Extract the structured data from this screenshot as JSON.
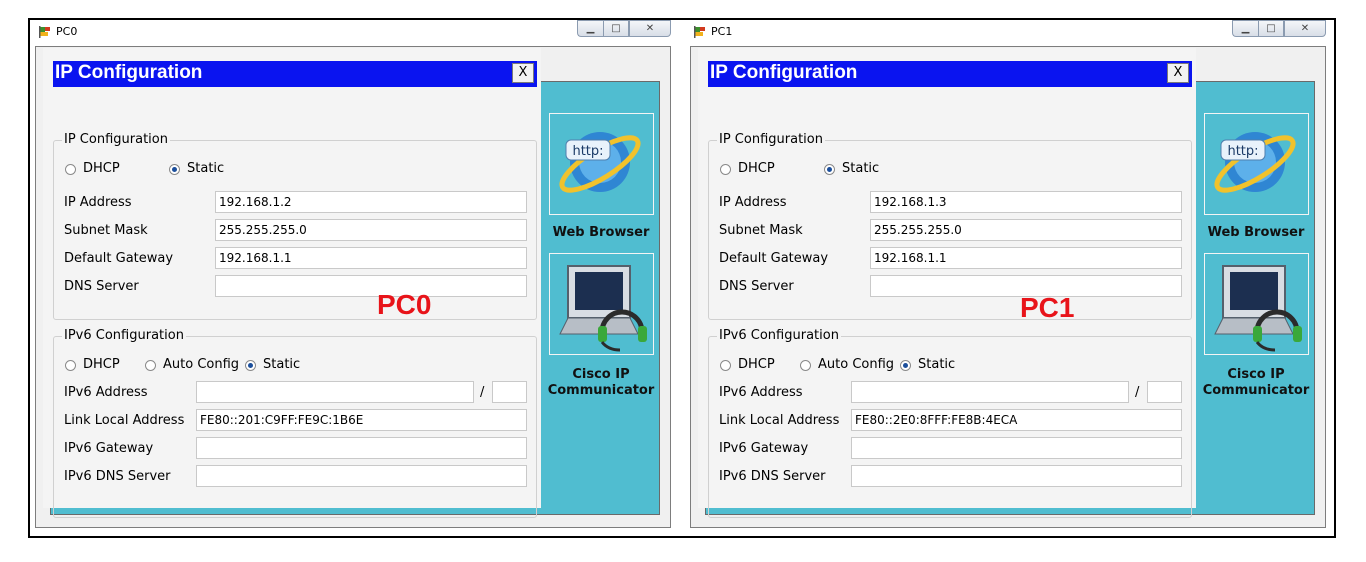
{
  "windows": [
    {
      "title": "PC0",
      "overlay_label": "PC0",
      "dialog_title": "IP Configuration",
      "close_label": "X",
      "ipv4": {
        "group_title": "IP Configuration",
        "dhcp_label": "DHCP",
        "static_label": "Static",
        "mode": "Static",
        "ip_label": "IP Address",
        "ip": "192.168.1.2",
        "mask_label": "Subnet Mask",
        "mask": "255.255.255.0",
        "gw_label": "Default Gateway",
        "gw": "192.168.1.1",
        "dns_label": "DNS Server",
        "dns": ""
      },
      "ipv6": {
        "group_title": "IPv6 Configuration",
        "dhcp_label": "DHCP",
        "auto_label": "Auto Config",
        "static_label": "Static",
        "mode": "Static",
        "addr_label": "IPv6 Address",
        "addr": "",
        "prefix_sep": "/",
        "prefix": "",
        "link_label": "Link Local Address",
        "link": "FE80::201:C9FF:FE9C:1B6E",
        "gw_label": "IPv6 Gateway",
        "gw": "",
        "dns_label": "IPv6 DNS Server",
        "dns": ""
      },
      "apps": [
        "Web Browser",
        "Cisco IP Communicator"
      ],
      "browser_icon_text": "http:"
    },
    {
      "title": "PC1",
      "overlay_label": "PC1",
      "dialog_title": "IP Configuration",
      "close_label": "X",
      "ipv4": {
        "group_title": "IP Configuration",
        "dhcp_label": "DHCP",
        "static_label": "Static",
        "mode": "Static",
        "ip_label": "IP Address",
        "ip": "192.168.1.3",
        "mask_label": "Subnet Mask",
        "mask": "255.255.255.0",
        "gw_label": "Default Gateway",
        "gw": "192.168.1.1",
        "dns_label": "DNS Server",
        "dns": ""
      },
      "ipv6": {
        "group_title": "IPv6 Configuration",
        "dhcp_label": "DHCP",
        "auto_label": "Auto Config",
        "static_label": "Static",
        "mode": "Static",
        "addr_label": "IPv6 Address",
        "addr": "",
        "prefix_sep": "/",
        "prefix": "",
        "link_label": "Link Local Address",
        "link": "FE80::2E0:8FFF:FE8B:4ECA",
        "gw_label": "IPv6 Gateway",
        "gw": "",
        "dns_label": "IPv6 DNS Server",
        "dns": ""
      },
      "apps": [
        "Web Browser",
        "Cisco IP Communicator"
      ],
      "browser_icon_text": "http:"
    }
  ],
  "colors": {
    "dialog_header": "#0a14f0",
    "desktop_teal": "#50bdd0",
    "overlay_label": "#e8141a"
  },
  "icons": [
    "packet-tracer-pc-icon",
    "web-browser-icon",
    "cisco-ip-communicator-icon"
  ]
}
